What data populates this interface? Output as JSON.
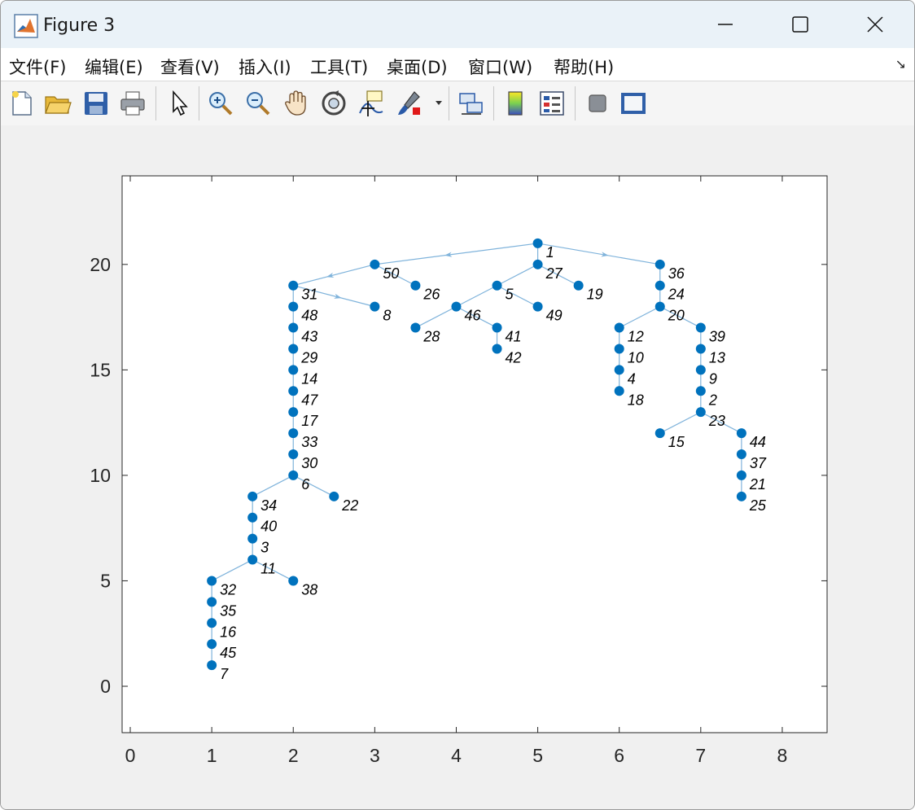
{
  "window": {
    "title": "Figure 3"
  },
  "menu": [
    "文件(F)",
    "编辑(E)",
    "查看(V)",
    "插入(I)",
    "工具(T)",
    "桌面(D)",
    "窗口(W)",
    "帮助(H)"
  ],
  "toolbar": {
    "buttons": [
      {
        "name": "new-figure-icon"
      },
      {
        "name": "open-file-icon"
      },
      {
        "name": "save-icon"
      },
      {
        "name": "print-icon"
      },
      {
        "name": "select-pointer-icon"
      },
      {
        "name": "zoom-in-icon"
      },
      {
        "name": "zoom-out-icon"
      },
      {
        "name": "pan-hand-icon"
      },
      {
        "name": "rotate-3d-icon"
      },
      {
        "name": "data-cursor-icon"
      },
      {
        "name": "brush-icon"
      },
      {
        "name": "link-plot-icon"
      },
      {
        "name": "colorbar-icon"
      },
      {
        "name": "legend-icon"
      },
      {
        "name": "hide-plot-tools-icon"
      },
      {
        "name": "show-plot-tools-icon"
      }
    ]
  },
  "colors": {
    "node": "#0072BD",
    "edge": "#7FB3DB",
    "titlebar": "#eaf2f8"
  },
  "chart_data": {
    "type": "scatter",
    "graph": "directed-tree",
    "title": "",
    "xlabel": "",
    "ylabel": "",
    "xlim": [
      -0.1,
      8.55
    ],
    "ylim": [
      -2.2,
      24.2
    ],
    "xticks": [
      0,
      1,
      2,
      3,
      4,
      5,
      6,
      7,
      8
    ],
    "yticks": [
      0,
      5,
      10,
      15,
      20
    ],
    "nodes": [
      {
        "id": "1",
        "x": 5,
        "y": 21
      },
      {
        "id": "50",
        "x": 3,
        "y": 20
      },
      {
        "id": "27",
        "x": 5,
        "y": 20
      },
      {
        "id": "36",
        "x": 6.5,
        "y": 20
      },
      {
        "id": "31",
        "x": 2,
        "y": 19
      },
      {
        "id": "26",
        "x": 3.5,
        "y": 19
      },
      {
        "id": "5",
        "x": 4.5,
        "y": 19
      },
      {
        "id": "19",
        "x": 5.5,
        "y": 19
      },
      {
        "id": "24",
        "x": 6.5,
        "y": 19
      },
      {
        "id": "48",
        "x": 2,
        "y": 18
      },
      {
        "id": "8",
        "x": 3,
        "y": 18
      },
      {
        "id": "46",
        "x": 4,
        "y": 18
      },
      {
        "id": "49",
        "x": 5,
        "y": 18
      },
      {
        "id": "20",
        "x": 6.5,
        "y": 18
      },
      {
        "id": "43",
        "x": 2,
        "y": 17
      },
      {
        "id": "28",
        "x": 3.5,
        "y": 17
      },
      {
        "id": "41",
        "x": 4.5,
        "y": 17
      },
      {
        "id": "12",
        "x": 6,
        "y": 17
      },
      {
        "id": "39",
        "x": 7,
        "y": 17
      },
      {
        "id": "29",
        "x": 2,
        "y": 16
      },
      {
        "id": "42",
        "x": 4.5,
        "y": 16
      },
      {
        "id": "10",
        "x": 6,
        "y": 16
      },
      {
        "id": "13",
        "x": 7,
        "y": 16
      },
      {
        "id": "14",
        "x": 2,
        "y": 15
      },
      {
        "id": "4",
        "x": 6,
        "y": 15
      },
      {
        "id": "9",
        "x": 7,
        "y": 15
      },
      {
        "id": "47",
        "x": 2,
        "y": 14
      },
      {
        "id": "18",
        "x": 6,
        "y": 14
      },
      {
        "id": "2",
        "x": 7,
        "y": 14
      },
      {
        "id": "17",
        "x": 2,
        "y": 13
      },
      {
        "id": "23",
        "x": 7,
        "y": 13
      },
      {
        "id": "33",
        "x": 2,
        "y": 12
      },
      {
        "id": "15",
        "x": 6.5,
        "y": 12
      },
      {
        "id": "44",
        "x": 7.5,
        "y": 12
      },
      {
        "id": "30",
        "x": 2,
        "y": 11
      },
      {
        "id": "37",
        "x": 7.5,
        "y": 11
      },
      {
        "id": "6",
        "x": 2,
        "y": 10
      },
      {
        "id": "21",
        "x": 7.5,
        "y": 10
      },
      {
        "id": "34",
        "x": 1.5,
        "y": 9
      },
      {
        "id": "22",
        "x": 2.5,
        "y": 9
      },
      {
        "id": "25",
        "x": 7.5,
        "y": 9
      },
      {
        "id": "40",
        "x": 1.5,
        "y": 8
      },
      {
        "id": "3",
        "x": 1.5,
        "y": 7
      },
      {
        "id": "11",
        "x": 1.5,
        "y": 6
      },
      {
        "id": "32",
        "x": 1,
        "y": 5
      },
      {
        "id": "38",
        "x": 2,
        "y": 5
      },
      {
        "id": "35",
        "x": 1,
        "y": 4
      },
      {
        "id": "16",
        "x": 1,
        "y": 3
      },
      {
        "id": "45",
        "x": 1,
        "y": 2
      },
      {
        "id": "7",
        "x": 1,
        "y": 1
      }
    ],
    "edges": [
      [
        "1",
        "50"
      ],
      [
        "1",
        "27"
      ],
      [
        "1",
        "36"
      ],
      [
        "50",
        "31"
      ],
      [
        "50",
        "26"
      ],
      [
        "27",
        "5"
      ],
      [
        "27",
        "19"
      ],
      [
        "36",
        "24"
      ],
      [
        "24",
        "20"
      ],
      [
        "31",
        "48"
      ],
      [
        "31",
        "8"
      ],
      [
        "5",
        "46"
      ],
      [
        "5",
        "49"
      ],
      [
        "46",
        "28"
      ],
      [
        "46",
        "41"
      ],
      [
        "41",
        "42"
      ],
      [
        "20",
        "12"
      ],
      [
        "20",
        "39"
      ],
      [
        "12",
        "10"
      ],
      [
        "10",
        "4"
      ],
      [
        "4",
        "18"
      ],
      [
        "39",
        "13"
      ],
      [
        "13",
        "9"
      ],
      [
        "9",
        "2"
      ],
      [
        "2",
        "23"
      ],
      [
        "23",
        "15"
      ],
      [
        "23",
        "44"
      ],
      [
        "44",
        "37"
      ],
      [
        "37",
        "21"
      ],
      [
        "21",
        "25"
      ],
      [
        "48",
        "43"
      ],
      [
        "43",
        "29"
      ],
      [
        "29",
        "14"
      ],
      [
        "14",
        "47"
      ],
      [
        "47",
        "17"
      ],
      [
        "17",
        "33"
      ],
      [
        "33",
        "30"
      ],
      [
        "30",
        "6"
      ],
      [
        "6",
        "34"
      ],
      [
        "6",
        "22"
      ],
      [
        "34",
        "40"
      ],
      [
        "40",
        "3"
      ],
      [
        "3",
        "11"
      ],
      [
        "11",
        "32"
      ],
      [
        "11",
        "38"
      ],
      [
        "32",
        "35"
      ],
      [
        "35",
        "16"
      ],
      [
        "16",
        "45"
      ],
      [
        "45",
        "7"
      ]
    ]
  }
}
